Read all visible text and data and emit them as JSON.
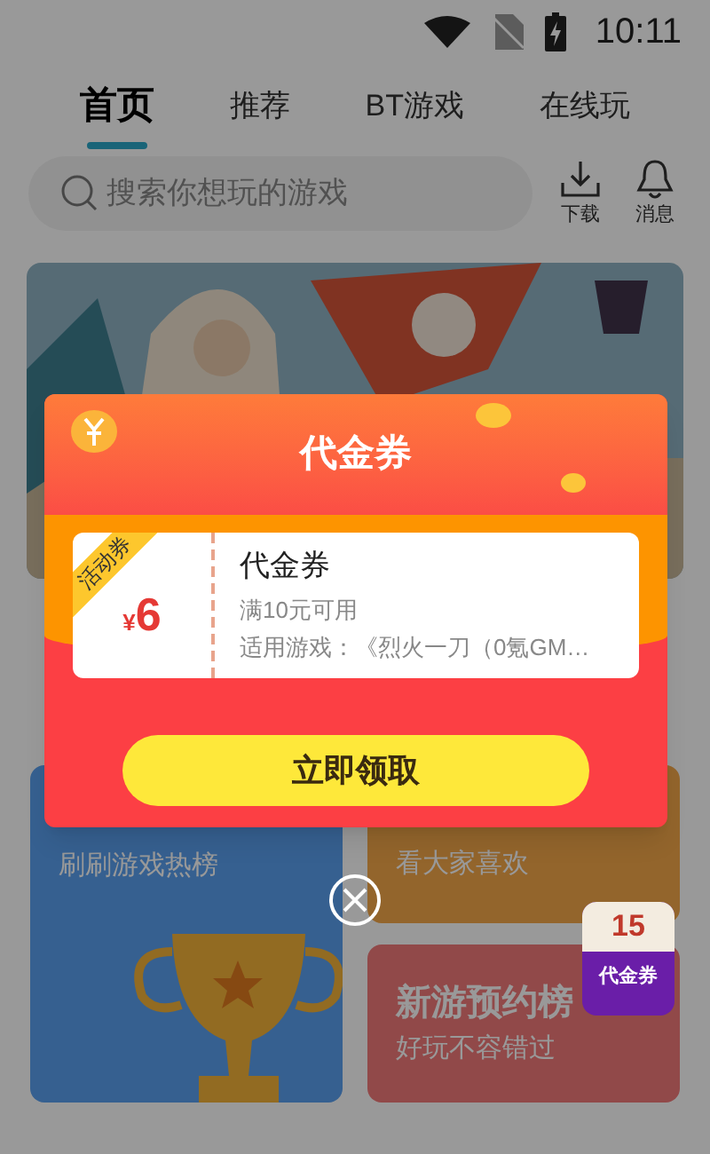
{
  "status_bar": {
    "time": "10:11"
  },
  "tabs": [
    {
      "label": "首页",
      "selected": true
    },
    {
      "label": "推荐",
      "selected": false
    },
    {
      "label": "BT游戏",
      "selected": false
    },
    {
      "label": "在线玩",
      "selected": false
    }
  ],
  "search": {
    "placeholder": "搜索你想玩的游戏"
  },
  "header_actions": [
    {
      "label": "下载",
      "kind": "download"
    },
    {
      "label": "消息",
      "kind": "bell"
    }
  ],
  "cards": [
    {
      "subtitle": "刷刷游戏热榜"
    },
    {
      "subtitle": "看大家喜欢"
    },
    {
      "title": "新游预约榜",
      "subtitle": "好玩不容错过"
    }
  ],
  "floating_badge": {
    "number": "15",
    "label": "代金券"
  },
  "dialog": {
    "title": "代金券",
    "coupon": {
      "tag": "活动券",
      "currency": "¥",
      "amount": "6",
      "name": "代金券",
      "condition": "满10元可用",
      "games": "适用游戏：《烈火一刀（0氪GM…"
    },
    "button": "立即领取"
  }
}
